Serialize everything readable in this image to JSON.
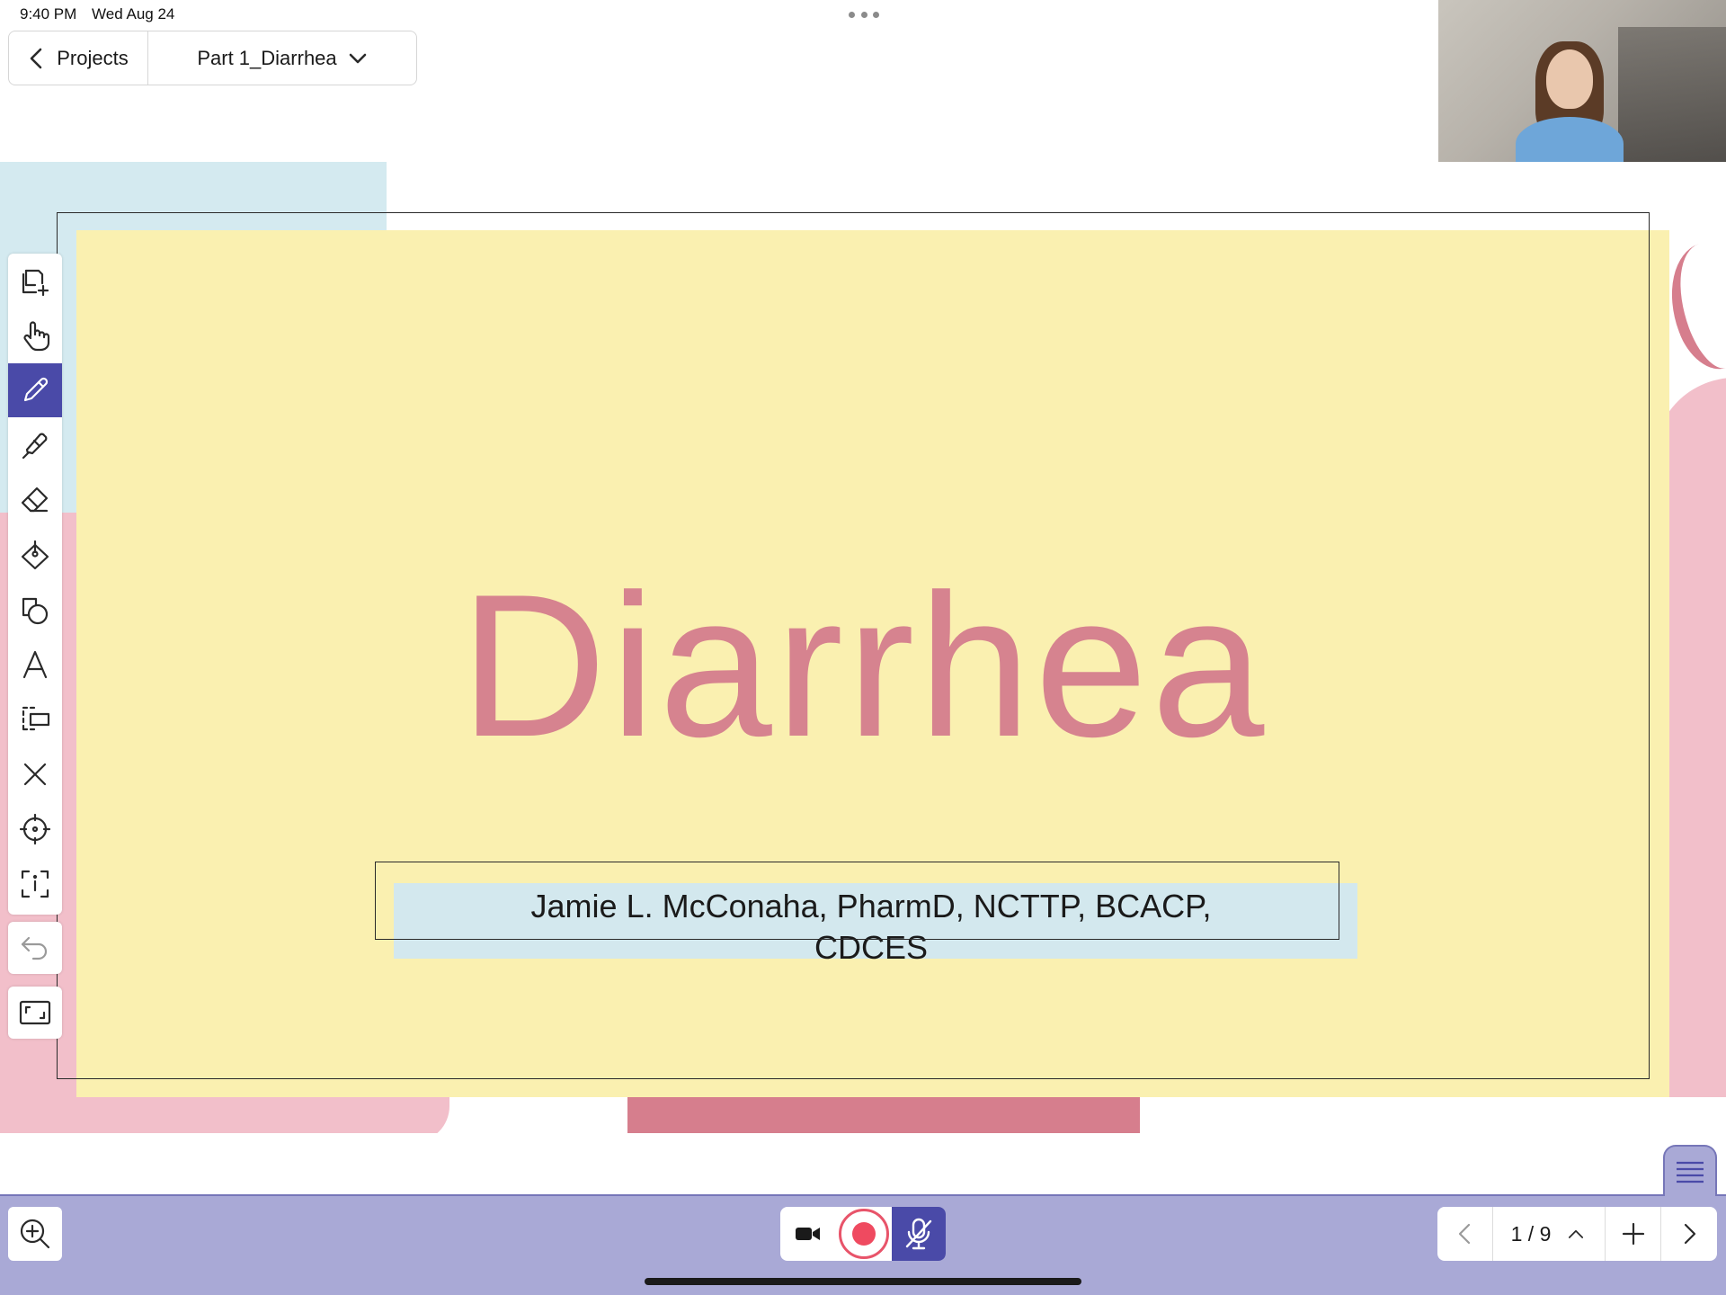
{
  "status": {
    "time": "9:40 PM",
    "date": "Wed Aug 24"
  },
  "nav": {
    "back_label": "Projects",
    "project_name": "Part 1_Diarrhea"
  },
  "slide": {
    "title": "Diarrhea",
    "subtitle_line1": "Jamie L. McConaha, PharmD, NCTTP, BCACP,",
    "subtitle_line2": "CDCES"
  },
  "toolbar": {
    "tools": [
      "add-page-icon",
      "hand-icon",
      "pen-icon",
      "highlighter-icon",
      "eraser-icon",
      "fill-icon",
      "shapes-icon",
      "text-icon",
      "select-icon",
      "close-icon",
      "laser-pointer-icon",
      "info-scan-icon"
    ],
    "active_tool": "pen-icon"
  },
  "pager": {
    "current": "1",
    "total": "9",
    "separator": "/"
  },
  "colors": {
    "accent": "#4a4aa8",
    "bottom_bar": "#a9a9d6",
    "record": "#ef4a60",
    "slide_bg": "#faf0b0",
    "title": "#d6838f"
  }
}
